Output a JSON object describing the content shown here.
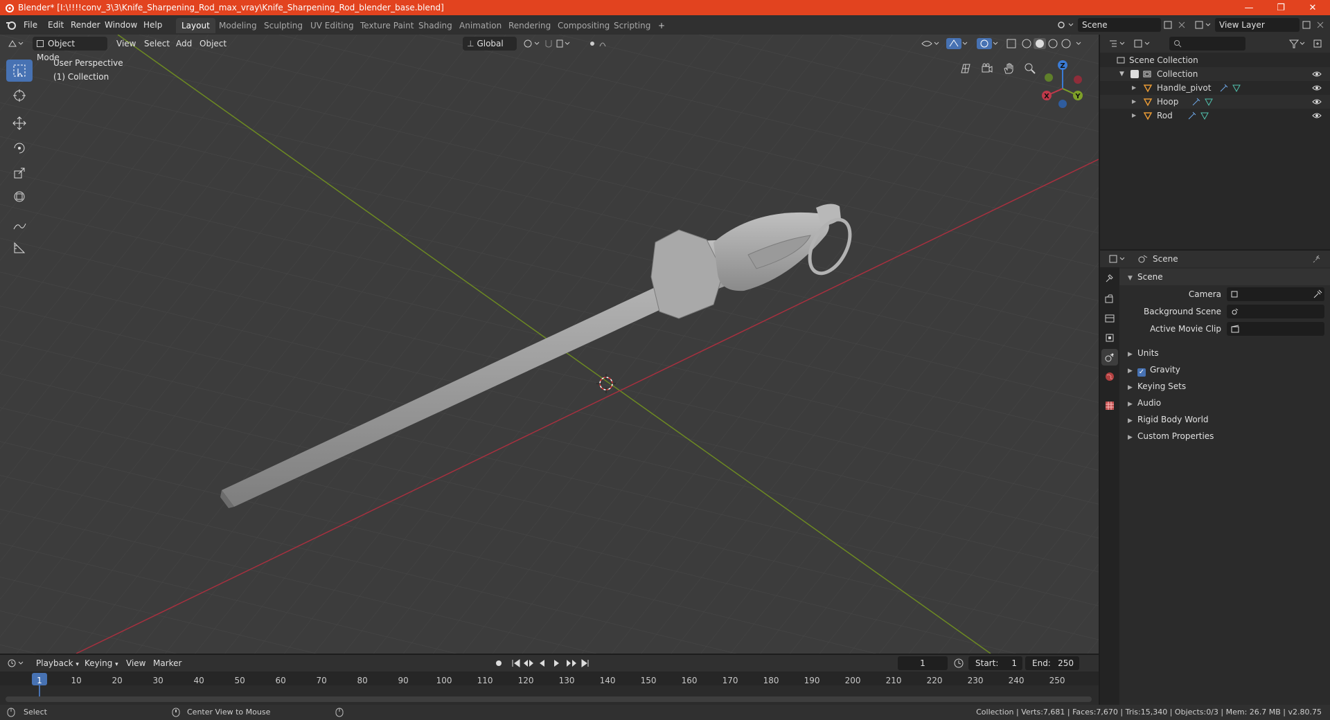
{
  "window": {
    "title": "Blender* [I:\\!!!!conv_3\\3\\Knife_Sharpening_Rod_max_vray\\Knife_Sharpening_Rod_blender_base.blend]",
    "controls": [
      "—",
      "❐",
      "✕"
    ]
  },
  "menu": [
    "File",
    "Edit",
    "Render",
    "Window",
    "Help"
  ],
  "workspaces": [
    "Layout",
    "Modeling",
    "Sculpting",
    "UV Editing",
    "Texture Paint",
    "Shading",
    "Animation",
    "Rendering",
    "Compositing",
    "Scripting",
    "+"
  ],
  "active_workspace": "Layout",
  "scene_field": "Scene",
  "view_layer_field": "View Layer",
  "viewport": {
    "mode": "Object Mode",
    "menus": [
      "View",
      "Select",
      "Add",
      "Object"
    ],
    "orientation": "Global",
    "overlay_title": "User Perspective",
    "overlay_subtitle": "(1) Collection",
    "gizmo": {
      "x": "X",
      "y": "Y",
      "z": "Z"
    }
  },
  "outliner": {
    "root": "Scene Collection",
    "collection": "Collection",
    "objects": [
      "Handle_pivot",
      "Hoop",
      "Rod"
    ]
  },
  "properties": {
    "header": "Scene",
    "panel": "Scene",
    "camera_label": "Camera",
    "bg_scene_label": "Background Scene",
    "movie_clip_label": "Active Movie Clip",
    "subpanels": [
      "Units",
      "Gravity",
      "Keying Sets",
      "Audio",
      "Rigid Body World",
      "Custom Properties"
    ],
    "gravity_checked": true
  },
  "timeline": {
    "menus": [
      "Playback",
      "Keying",
      "View",
      "Marker"
    ],
    "current_frame": "1",
    "start_label": "Start:",
    "start": "1",
    "end_label": "End:",
    "end": "250",
    "ticks": [
      "1",
      "10",
      "20",
      "30",
      "40",
      "50",
      "60",
      "70",
      "80",
      "90",
      "100",
      "110",
      "120",
      "130",
      "140",
      "150",
      "160",
      "170",
      "180",
      "190",
      "200",
      "210",
      "220",
      "230",
      "240",
      "250"
    ]
  },
  "status": {
    "left_action": "Select",
    "middle_action": "Center View to Mouse",
    "stats": "Collection | Verts:7,681 | Faces:7,670 | Tris:15,340 | Objects:0/3 | Mem: 26.7 MB | v2.80.75"
  },
  "colors": {
    "accent": "#4772b3",
    "titlebar": "#e2431f",
    "x_axis": "#c0394a",
    "y_axis": "#7ea028",
    "z_axis": "#3a7bd5"
  }
}
